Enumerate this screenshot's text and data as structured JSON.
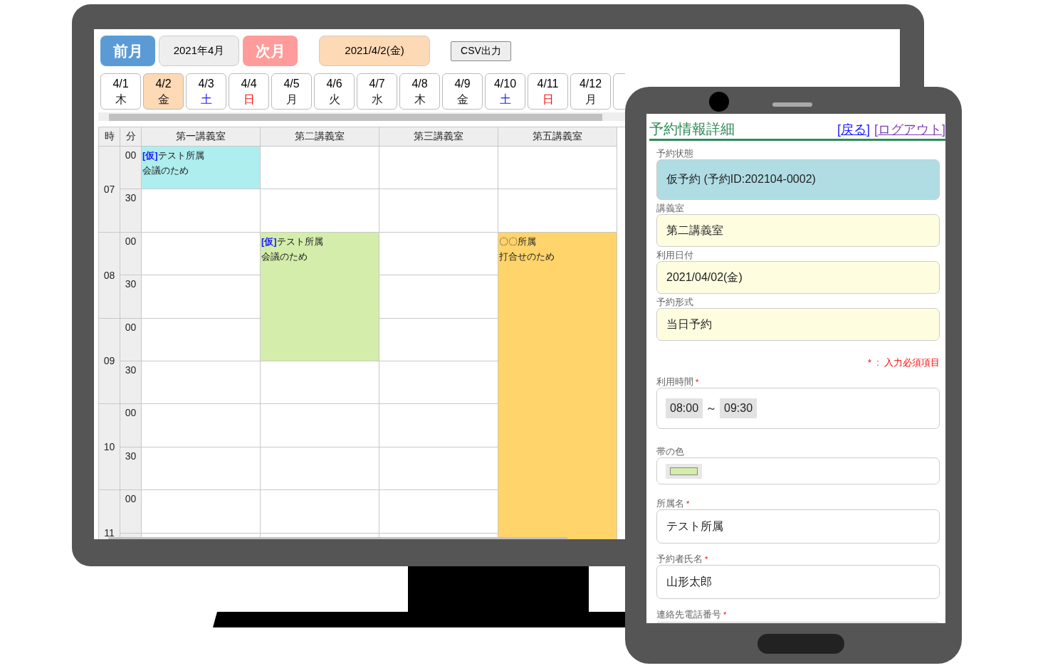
{
  "calendar": {
    "prev_button": "前月",
    "month": "2021年4月",
    "next_button": "次月",
    "date_button": "2021/4/2(金)",
    "csv_button": "CSV出力",
    "days": [
      {
        "date": "4/1",
        "weekday": "木",
        "color": "#222222",
        "selected": false
      },
      {
        "date": "4/2",
        "weekday": "金",
        "color": "#222222",
        "selected": true
      },
      {
        "date": "4/3",
        "weekday": "土",
        "color": "#1a1aff",
        "selected": false
      },
      {
        "date": "4/4",
        "weekday": "日",
        "color": "#f01010",
        "selected": false
      },
      {
        "date": "4/5",
        "weekday": "月",
        "color": "#222222",
        "selected": false
      },
      {
        "date": "4/6",
        "weekday": "火",
        "color": "#222222",
        "selected": false
      },
      {
        "date": "4/7",
        "weekday": "水",
        "color": "#222222",
        "selected": false
      },
      {
        "date": "4/8",
        "weekday": "木",
        "color": "#222222",
        "selected": false
      },
      {
        "date": "4/9",
        "weekday": "金",
        "color": "#222222",
        "selected": false
      },
      {
        "date": "4/10",
        "weekday": "土",
        "color": "#1a1aff",
        "selected": false
      },
      {
        "date": "4/11",
        "weekday": "日",
        "color": "#f01010",
        "selected": false
      },
      {
        "date": "4/12",
        "weekday": "月",
        "color": "#222222",
        "selected": false
      }
    ],
    "columns": [
      "時",
      "分",
      "第一講義室",
      "第二講義室",
      "第三講義室",
      "第五講義室"
    ],
    "hours": [
      {
        "hour": "07",
        "slots": [
          {
            "minute": "00",
            "cells": [
              {
                "kind": "event",
                "title": "**[仮]**テスト所属",
                "note": "会議のため",
                "color": "#aeeeee"
              },
              {
                "kind": "empty"
              },
              {
                "kind": "empty"
              },
              {
                "kind": "empty"
              }
            ]
          },
          {
            "minute": "30",
            "cells": [
              {
                "kind": "empty"
              },
              {
                "kind": "empty"
              },
              {
                "kind": "empty"
              },
              {
                "kind": "empty"
              }
            ]
          }
        ]
      },
      {
        "hour": "08",
        "slots": [
          {
            "minute": "00",
            "cells": [
              {
                "kind": "empty"
              },
              {
                "kind": "event",
                "title": "**[仮]**テスト所属",
                "note": "会議のため",
                "color": "#d4edaa"
              },
              {
                "kind": "empty"
              },
              {
                "kind": "event",
                "title": "〇〇所属",
                "note": "打合せのため",
                "color": "#ffd46b"
              }
            ]
          },
          {
            "minute": "30",
            "cells": [
              {
                "kind": "empty"
              },
              {
                "kind": "continued"
              },
              {
                "kind": "empty"
              },
              {
                "kind": "continued"
              }
            ]
          }
        ]
      },
      {
        "hour": "09",
        "slots": [
          {
            "minute": "00",
            "cells": [
              {
                "kind": "empty"
              },
              {
                "kind": "continued"
              },
              {
                "kind": "empty"
              },
              {
                "kind": "continued"
              }
            ]
          },
          {
            "minute": "30",
            "cells": [
              {
                "kind": "empty"
              },
              {
                "kind": "empty"
              },
              {
                "kind": "empty"
              },
              {
                "kind": "continued"
              }
            ]
          }
        ]
      },
      {
        "hour": "10",
        "slots": [
          {
            "minute": "00",
            "cells": [
              {
                "kind": "empty"
              },
              {
                "kind": "empty"
              },
              {
                "kind": "empty"
              },
              {
                "kind": "continued"
              }
            ]
          },
          {
            "minute": "30",
            "cells": [
              {
                "kind": "empty"
              },
              {
                "kind": "empty"
              },
              {
                "kind": "empty"
              },
              {
                "kind": "continued"
              }
            ]
          }
        ]
      },
      {
        "hour": "11",
        "slots": [
          {
            "minute": "00",
            "cells": [
              {
                "kind": "empty"
              },
              {
                "kind": "empty"
              },
              {
                "kind": "empty"
              },
              {
                "kind": "continued"
              }
            ]
          },
          {
            "cells": [
              {
                "kind": "empty"
              },
              {
                "kind": "empty"
              },
              {
                "kind": "empty"
              },
              {
                "kind": "continued"
              }
            ]
          }
        ]
      }
    ]
  },
  "detail": {
    "title": "予約情報詳細",
    "links": [
      {
        "text": "[戻る]",
        "visited": false
      },
      {
        "text": "[ログアウト]",
        "visited": true
      }
    ],
    "required_note": "*  :  入力必須項目",
    "fields": [
      {
        "kind": "status",
        "label": "予約状態",
        "value": "仮予約 (予約ID:202104-0002)"
      },
      {
        "kind": "readonly",
        "label": "講義室",
        "value": "第二講義室"
      },
      {
        "kind": "readonly",
        "label": "利用日付",
        "value": "2021/04/02(金)"
      },
      {
        "kind": "readonly",
        "label": "予約形式",
        "value": "当日予約"
      },
      {
        "kind": "note"
      },
      {
        "kind": "time",
        "label": "利用時間",
        "required_mark": "*",
        "from": "08:00",
        "separator": "～",
        "to": "09:30"
      },
      {
        "kind": "color",
        "label": "帯の色",
        "color": "#d4edaa"
      },
      {
        "kind": "text",
        "label": "所属名",
        "required_mark": "*",
        "value": "テスト所属"
      },
      {
        "kind": "text",
        "label": "予約者氏名",
        "required_mark": "*",
        "value": "山形太郎"
      },
      {
        "kind": "text",
        "label": "連絡先電話番号",
        "required_mark": "*"
      }
    ]
  }
}
